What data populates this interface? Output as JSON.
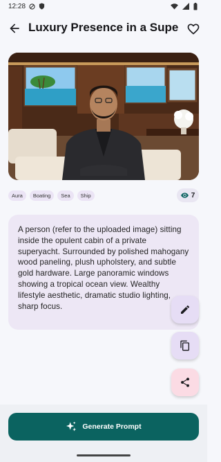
{
  "status_bar": {
    "time": "12:28"
  },
  "app_bar": {
    "title": "Luxury Presence in a Superyacht"
  },
  "tags": [
    "Aura",
    "Boating",
    "Sea",
    "Ship"
  ],
  "views": {
    "count": "7"
  },
  "prompt": {
    "text": "A person (refer to the uploaded image) sitting inside the opulent cabin of a private superyacht. Surrounded by polished mahogany wood paneling, plush upholstery, and subtle gold hardware. Large panoramic windows showing a tropical ocean view. Wealthy lifestyle aesthetic, dramatic studio lighting, sharp focus."
  },
  "actions": {
    "generate_label": "Generate Prompt"
  },
  "colors": {
    "accent": "#0b6360",
    "tag_bg": "#ebe4f5",
    "card_bg": "#ede7f5",
    "share_fab": "#fbdbe4"
  }
}
